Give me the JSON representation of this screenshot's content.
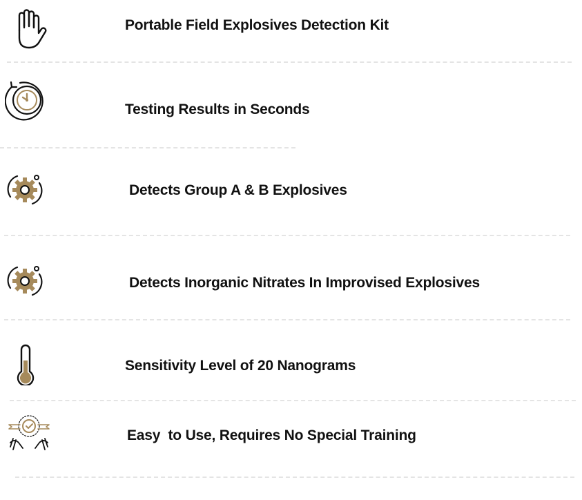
{
  "features": [
    {
      "icon": "hand-icon",
      "label": "Portable Field Explosives Detection Kit"
    },
    {
      "icon": "stopwatch-icon",
      "label": "Testing Results in Seconds"
    },
    {
      "icon": "gear-icon",
      "label": "Detects Group A & B Explosives"
    },
    {
      "icon": "gear-icon",
      "label": "Detects Inorganic Nitrates In Improvised Explosives"
    },
    {
      "icon": "thermometer-icon",
      "label": "Sensitivity Level of 20 Nanograms"
    },
    {
      "icon": "hands-badge-icon",
      "label": "Easy  to Use, Requires No Special Training"
    }
  ],
  "colors": {
    "accent": "#a68a5b",
    "text": "#111111",
    "divider": "#e4e4e4"
  }
}
